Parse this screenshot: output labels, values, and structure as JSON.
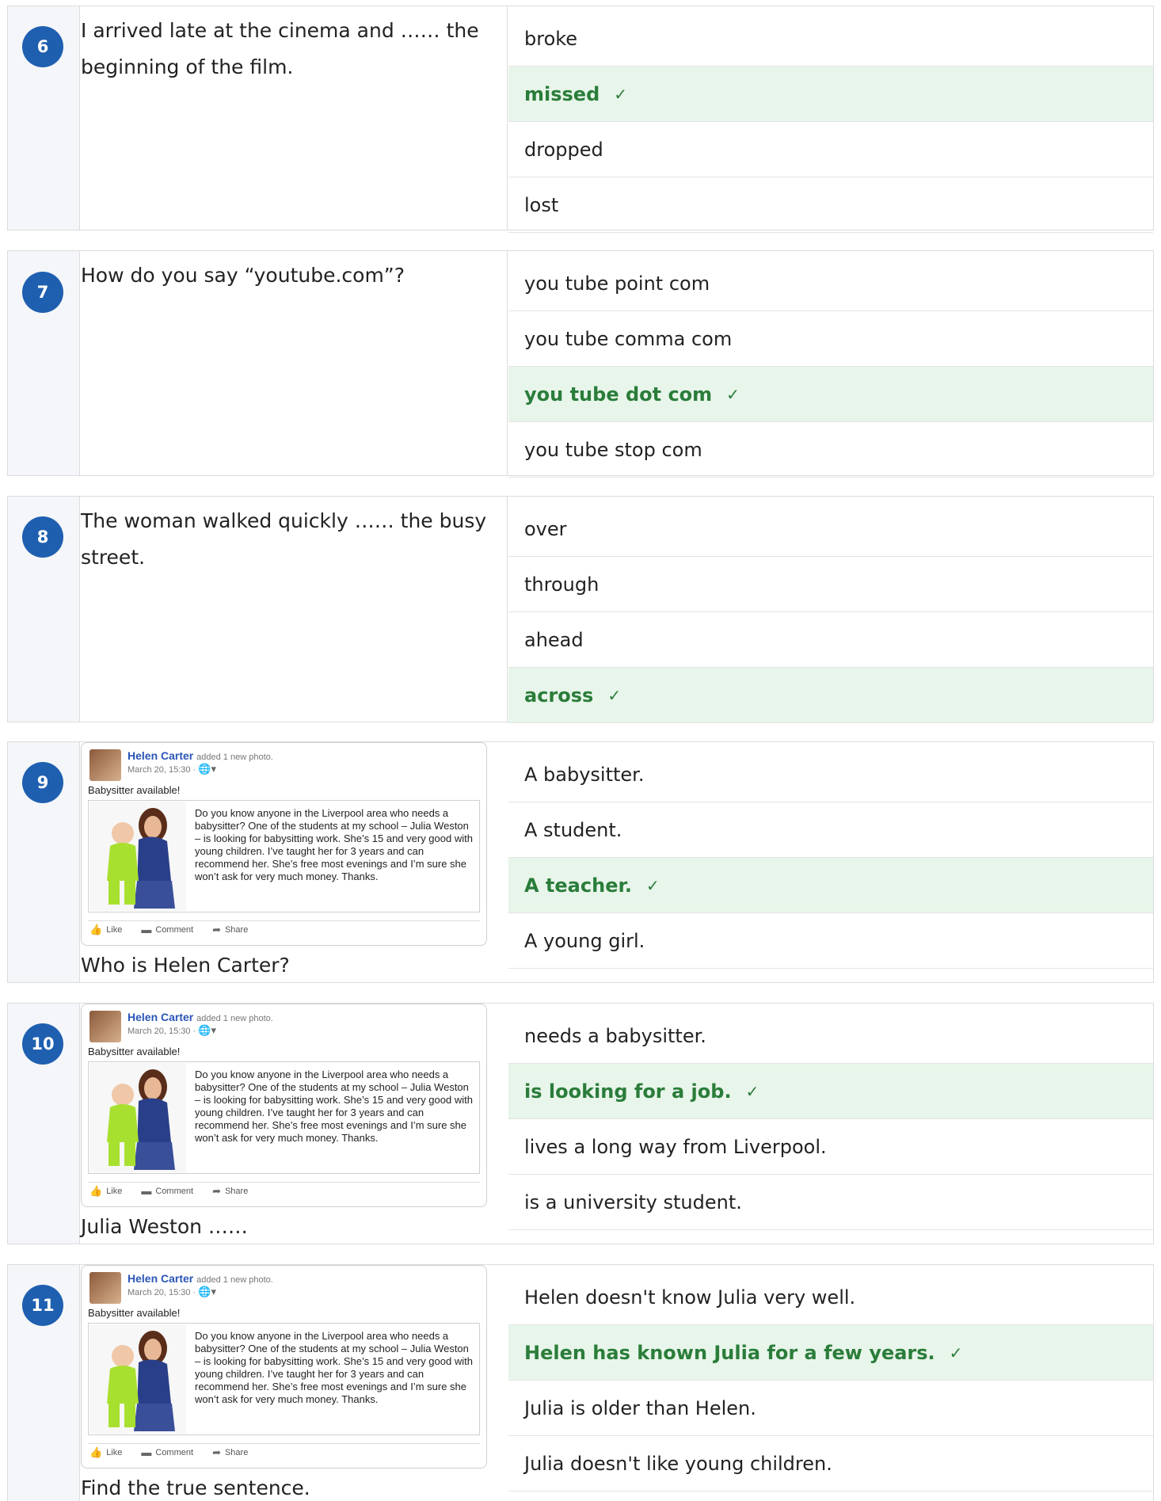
{
  "questions": [
    {
      "number": "6",
      "text": "I arrived late at the cinema and …… the beginning of the film.",
      "options": [
        {
          "label": "broke",
          "correct": false
        },
        {
          "label": "missed",
          "correct": true
        },
        {
          "label": "dropped",
          "correct": false
        },
        {
          "label": "lost",
          "correct": false
        }
      ]
    },
    {
      "number": "7",
      "text": "How do you say “youtube.com”?",
      "options": [
        {
          "label": "you tube point com",
          "correct": false
        },
        {
          "label": "you tube comma com",
          "correct": false
        },
        {
          "label": "you tube dot com",
          "correct": true
        },
        {
          "label": "you tube stop com",
          "correct": false
        }
      ]
    },
    {
      "number": "8",
      "text": "The woman walked quickly …… the busy street.",
      "options": [
        {
          "label": "over",
          "correct": false
        },
        {
          "label": "through",
          "correct": false
        },
        {
          "label": "ahead",
          "correct": false
        },
        {
          "label": "across",
          "correct": true
        }
      ]
    },
    {
      "number": "9",
      "caption": "Who is Helen Carter?",
      "options": [
        {
          "label": "A babysitter.",
          "correct": false
        },
        {
          "label": "A student.",
          "correct": false
        },
        {
          "label": "A teacher.",
          "correct": true
        },
        {
          "label": "A young girl.",
          "correct": false
        }
      ]
    },
    {
      "number": "10",
      "caption": "Julia Weston ……",
      "options": [
        {
          "label": "needs a babysitter.",
          "correct": false
        },
        {
          "label": "is looking for a job.",
          "correct": true
        },
        {
          "label": "lives a long way from Liverpool.",
          "correct": false
        },
        {
          "label": "is a university student.",
          "correct": false
        }
      ]
    },
    {
      "number": "11",
      "caption": "Find the true sentence.",
      "options": [
        {
          "label": "Helen doesn't know Julia very well.",
          "correct": false
        },
        {
          "label": "Helen has known Julia for a few years.",
          "correct": true
        },
        {
          "label": "Julia is older than Helen.",
          "correct": false
        },
        {
          "label": "Julia doesn't like young children.",
          "correct": false
        }
      ]
    }
  ],
  "post": {
    "name": "Helen Carter",
    "added": "added 1 new photo.",
    "date": "March 20, 15:30 ·",
    "title": "Babysitter available!",
    "body": "Do you know anyone in the Liverpool area who needs a babysitter? One of the students at my school – Julia Weston – is looking for babysitting work. She’s 15 and very good with young children. I’ve taught her for 3 years and can recommend her. She’s free most evenings and I’m sure she won’t ask for very much money. Thanks.",
    "like": "Like",
    "comment": "Comment",
    "share": "Share"
  },
  "check_mark": "✓",
  "colors": {
    "badge": "#1f5fb0",
    "correct_bg": "#e8f5ea",
    "correct_text": "#2a7d3a",
    "link_name": "#2a55b8"
  }
}
